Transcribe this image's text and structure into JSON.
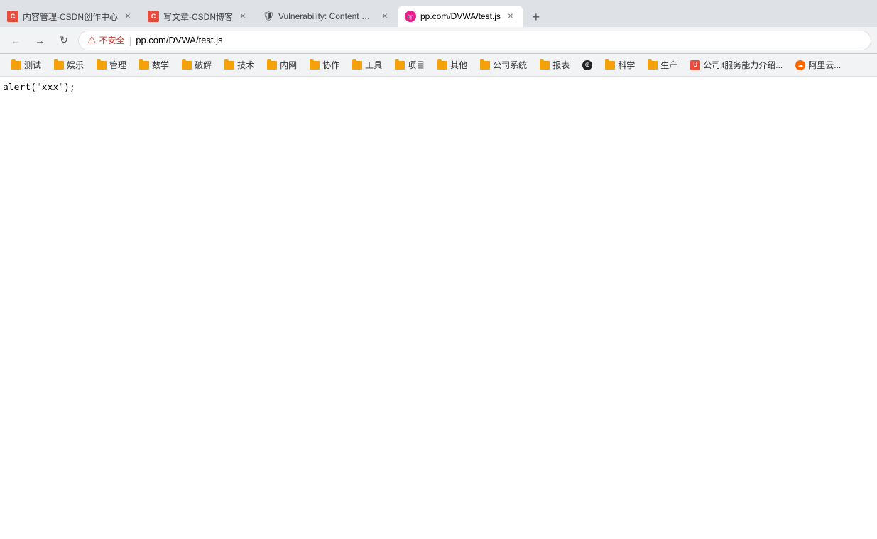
{
  "tabs": [
    {
      "id": "tab1",
      "title": "内容管理-CSDN创作中心",
      "favicon_type": "csdn",
      "active": false
    },
    {
      "id": "tab2",
      "title": "写文章-CSDN博客",
      "favicon_type": "csdn",
      "active": false
    },
    {
      "id": "tab3",
      "title": "Vulnerability: Content Security...",
      "favicon_type": "shield",
      "active": false
    },
    {
      "id": "tab4",
      "title": "pp.com/DVWA/test.js",
      "favicon_type": "pink",
      "active": true
    }
  ],
  "address_bar": {
    "security_label": "不安全",
    "url": "pp.com/DVWA/test.js"
  },
  "bookmarks": [
    {
      "id": "bm1",
      "label": "测试",
      "icon": "folder"
    },
    {
      "id": "bm2",
      "label": "娱乐",
      "icon": "folder"
    },
    {
      "id": "bm3",
      "label": "管理",
      "icon": "folder"
    },
    {
      "id": "bm4",
      "label": "数学",
      "icon": "folder"
    },
    {
      "id": "bm5",
      "label": "破解",
      "icon": "folder"
    },
    {
      "id": "bm6",
      "label": "技术",
      "icon": "folder"
    },
    {
      "id": "bm7",
      "label": "内网",
      "icon": "folder"
    },
    {
      "id": "bm8",
      "label": "协作",
      "icon": "folder"
    },
    {
      "id": "bm9",
      "label": "工具",
      "icon": "folder"
    },
    {
      "id": "bm10",
      "label": "项目",
      "icon": "folder"
    },
    {
      "id": "bm11",
      "label": "其他",
      "icon": "folder"
    },
    {
      "id": "bm12",
      "label": "公司系统",
      "icon": "folder"
    },
    {
      "id": "bm13",
      "label": "报表",
      "icon": "folder"
    },
    {
      "id": "bm14",
      "label": "",
      "icon": "earth"
    },
    {
      "id": "bm15",
      "label": "科学",
      "icon": "folder"
    },
    {
      "id": "bm16",
      "label": "生产",
      "icon": "folder"
    },
    {
      "id": "bm17",
      "label": "公司it服务能力介绍...",
      "icon": "u"
    },
    {
      "id": "bm18",
      "label": "阿里云...",
      "icon": "ali"
    }
  ],
  "page": {
    "content": "alert(\"xxx\");"
  }
}
